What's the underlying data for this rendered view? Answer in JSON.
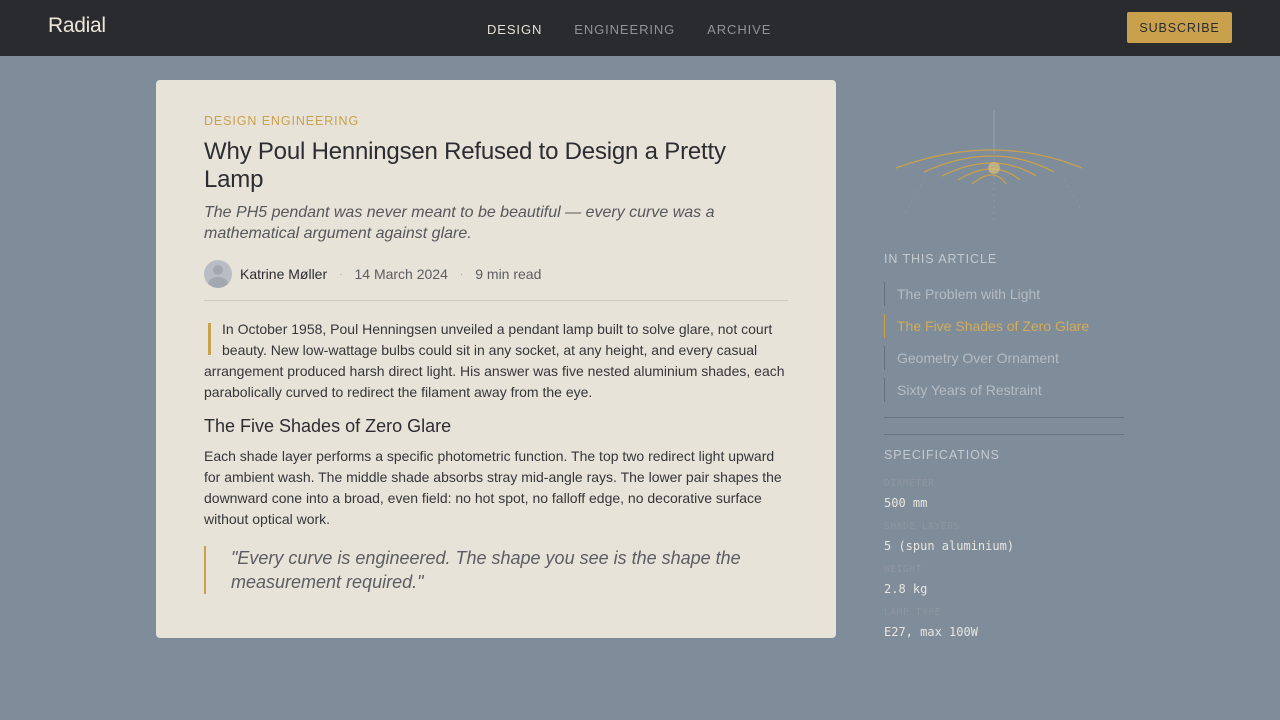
{
  "header": {
    "brand": "Radial",
    "nav": [
      "DESIGN",
      "ENGINEERING",
      "ARCHIVE"
    ],
    "subscribe_label": "SUBSCRIBE"
  },
  "article": {
    "category": "DESIGN ENGINEERING",
    "title": "Why Poul Henningsen Refused to Design a Pretty Lamp",
    "dek": "The PH5 pendant was never meant to be beautiful — every curve was a mathematical argument against glare.",
    "author": "Katrine Møller",
    "date": "14 March 2024",
    "read_time": "9 min read",
    "lead": "In October 1958, Poul Henningsen unveiled a pendant lamp built to solve glare, not court beauty. New low-wattage bulbs could sit in any socket, at any height, and every casual arrangement produced harsh direct light. His answer was five nested aluminium shades, each parabolically curved to redirect the filament away from the eye.",
    "section_title": "The Five Shades of Zero Glare",
    "para2": "Each shade layer performs a specific photometric function. The top two redirect light upward for ambient wash. The middle shade absorbs stray mid-angle rays. The lower pair shapes the downward cone into a broad, even field: no hot spot, no falloff edge, no decorative surface without optical work.",
    "quote": "\"Every curve is engineered. The shape you see is the shape the measurement required.\""
  },
  "sidebar": {
    "toc_heading": "IN THIS ARTICLE",
    "toc": [
      "The Problem with Light",
      "The Five Shades of Zero Glare",
      "Geometry Over Ornament",
      "Sixty Years of Restraint"
    ],
    "specs_heading": "SPECIFICATIONS",
    "specs": [
      {
        "label": "DIAMETER",
        "value": "500 mm"
      },
      {
        "label": "SHADE LAYERS",
        "value": "5 (spun aluminium)"
      },
      {
        "label": "WEIGHT",
        "value": "2.8 kg"
      },
      {
        "label": "LAMP TYPE",
        "value": "E27, max 100W"
      }
    ]
  },
  "colors": {
    "accent": "#c9a14c",
    "topbar": "#2a2b2f",
    "page_bg": "#7f8c99",
    "card_bg": "#e8e3d8"
  }
}
